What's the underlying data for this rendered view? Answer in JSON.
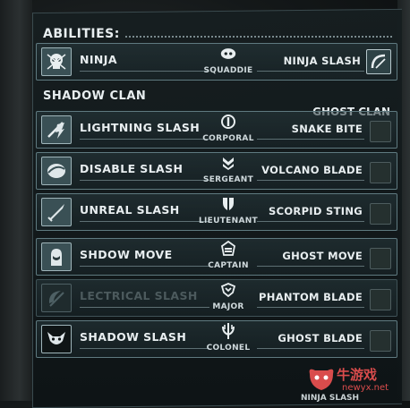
{
  "header": {
    "title": "ABILITIES:"
  },
  "top_ability": {
    "left_label": "NINJA",
    "rank": "SQUADDIE",
    "right_label": "NINJA SLASH"
  },
  "clans": {
    "left": "SHADOW CLAN",
    "right": "GHOST CLAN"
  },
  "rows": [
    {
      "left_label": "LIGHTNING SLASH",
      "rank": "CORPORAL",
      "right_label": "SNAKE BITE",
      "rank_icon": "corporal-icon",
      "ability_icon": "lightning-slash-icon"
    },
    {
      "left_label": "DISABLE SLASH",
      "rank": "SERGEANT",
      "right_label": "VOLCANO BLADE",
      "rank_icon": "sergeant-icon",
      "ability_icon": "disable-slash-icon"
    },
    {
      "left_label": "UNREAL SLASH",
      "rank": "LIEUTENANT",
      "right_label": "SCORPID STING",
      "rank_icon": "lieutenant-icon",
      "ability_icon": "unreal-slash-icon"
    },
    {
      "left_label": "SHDOW MOVE",
      "rank": "CAPTAIN",
      "right_label": "GHOST MOVE",
      "rank_icon": "captain-icon",
      "ability_icon": "shadow-move-icon"
    },
    {
      "left_label": "LECTRICAL SLASH",
      "rank": "MAJOR",
      "right_label": "PHANTOM BLADE",
      "rank_icon": "major-icon",
      "ability_icon": "electrical-slash-icon"
    },
    {
      "left_label": "SHADOW SLASH",
      "rank": "COLONEL",
      "right_label": "GHOST BLADE",
      "rank_icon": "colonel-icon",
      "ability_icon": "shadow-slash-icon"
    }
  ],
  "bottom_fragment": "NINJA SLASH",
  "watermark": {
    "text": "牛游戏",
    "sub": "newyx.net"
  },
  "colors": {
    "panel_border": "#5f7a80",
    "accent_red": "#d94c4c",
    "text": "#e8eef0"
  }
}
